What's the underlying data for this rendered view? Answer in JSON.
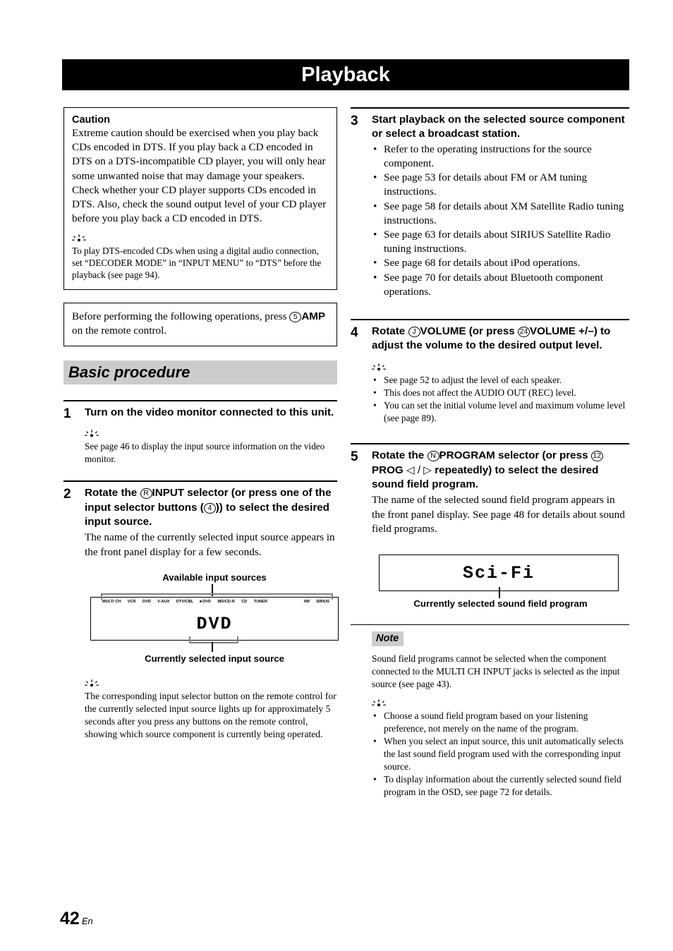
{
  "page": {
    "title": "Playback",
    "footer_page_number": "42",
    "footer_language": "En"
  },
  "left_column": {
    "caution_box": {
      "heading": "Caution",
      "body": "Extreme caution should be exercised when you play back CDs encoded in DTS. If you play back a CD encoded in DTS on a DTS-incompatible CD player, you will only hear some unwanted noise that may damage your speakers. Check whether your CD player supports CDs encoded in DTS. Also, check the sound output level of your CD player before you play back a CD encoded in DTS.",
      "tip": "To play DTS-encoded CDs when using a digital audio connection, set “DECODER MODE” in “INPUT MENU” to “DTS” before the playback (see page 94)."
    },
    "amp_box": {
      "text_before": "Before performing the following operations, press",
      "keycap": "5",
      "keycap_label": "AMP",
      "text_after": "on the remote control."
    },
    "section_heading": "Basic procedure",
    "step1": {
      "number": "1",
      "heading": "Turn on the video monitor connected to this unit.",
      "tip": "See page 46 to display the input source information on the video monitor."
    },
    "step2": {
      "number": "2",
      "heading_part1": "Rotate the",
      "heading_keycap1": "R",
      "heading_keycap1_label": "INPUT",
      "heading_part2": "selector (or press one of the input selector buttons (",
      "heading_keycap2": "4",
      "heading_part3": ")) to select the desired input source.",
      "body": "The name of the currently selected input source appears in the front panel display for a few seconds.",
      "figure": {
        "caption_top": "Available input sources",
        "caption_bottom": "Currently selected input source",
        "indicators": [
          {
            "label": "MULTI CH",
            "active": false
          },
          {
            "label": "VCR",
            "active": false
          },
          {
            "label": "DVR",
            "active": false
          },
          {
            "label": "V-AUX",
            "active": false
          },
          {
            "label": "DTV/CBL",
            "active": false
          },
          {
            "label": "DVD",
            "active": true
          },
          {
            "label": "MD/CD-R",
            "active": false
          },
          {
            "label": "CD",
            "active": false
          },
          {
            "label": "TUNER",
            "active": false
          },
          {
            "label": "XM",
            "active": false
          },
          {
            "label": "SIRIUS",
            "active": false
          }
        ],
        "lcd_value": "DVD"
      },
      "tip": "The corresponding input selector button on the remote control for the currently selected input source lights up for approximately 5 seconds after you press any buttons on the remote control, showing which source component is currently being operated."
    }
  },
  "right_column": {
    "step3": {
      "number": "3",
      "heading": "Start playback on the selected source component or select a broadcast station.",
      "bullets": [
        "Refer to the operating instructions for the source component.",
        "See page 53 for details about FM or AM tuning instructions.",
        "See page 58 for details about XM Satellite Radio tuning instructions.",
        "See page 63 for details about SIRIUS Satellite Radio tuning instructions.",
        "See page 68 for details about iPod operations.",
        "See page 70 for details about Bluetooth component operations."
      ]
    },
    "step4": {
      "number": "4",
      "heading_part1": "Rotate",
      "heading_keycap1": "J",
      "heading_keycap1_label": "VOLUME",
      "heading_part2": "(or press",
      "heading_keycap2": "24",
      "heading_keycap2_label": "VOLUME +/–",
      "heading_part3": ") to adjust the volume to the desired output level.",
      "bullets": [
        "See page 52 to adjust the level of each speaker.",
        "This does not affect the AUDIO OUT (REC) level.",
        "You can set the initial volume level and maximum volume level (see page 89)."
      ]
    },
    "step5": {
      "number": "5",
      "heading_part1": "Rotate the",
      "heading_keycap1": "N",
      "heading_keycap1_label": "PROGRAM",
      "heading_part2": "selector (or press",
      "heading_keycap2": "12",
      "heading_keycap2_label": "PROG",
      "heading_arrows": "◁ / ▷",
      "heading_part3": "repeatedly) to select the desired sound field program.",
      "body": "The name of the selected sound field program appears in the front panel display. See page 48 for details about sound field programs.",
      "figure": {
        "lcd_value": "Sci-Fi",
        "caption_bottom": "Currently selected sound field program"
      }
    },
    "note_block": {
      "badge": "Note",
      "body": "Sound field programs cannot be selected when the component connected to the MULTI CH INPUT jacks is selected as the input source (see page 43).",
      "bullets": [
        "Choose a sound field program based on your listening preference, not merely on the name of the program.",
        "When you select an input source, this unit automatically selects the last sound field program used with the corresponding input source.",
        "To display information about the currently selected sound field program in the OSD, see page 72 for details."
      ]
    }
  },
  "colors": {
    "title_bar_bg": "#000000",
    "title_bar_fg": "#ffffff",
    "band_bg": "#cccccc",
    "bracket": "#808080"
  }
}
